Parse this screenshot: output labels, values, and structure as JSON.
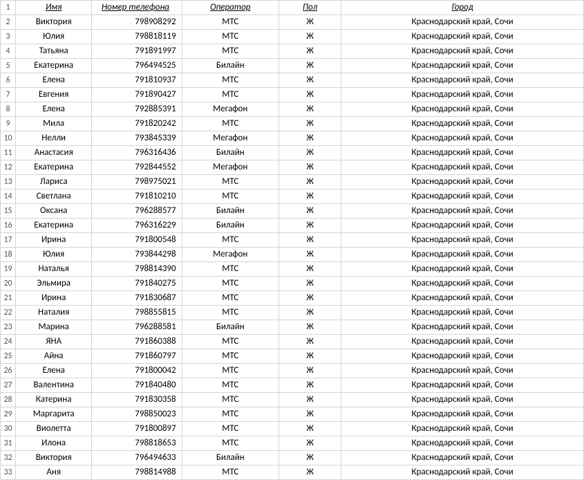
{
  "headers": {
    "rownum": "1",
    "name": "Имя",
    "phone": "Номер телефона",
    "operator": "Оператор",
    "sex": "Пол",
    "city": "Город"
  },
  "rows": [
    {
      "n": "2",
      "name": "Виктория",
      "phone": "798908292",
      "op": "МТС",
      "sex": "Ж",
      "city": "Краснодарский край, Сочи"
    },
    {
      "n": "3",
      "name": "Юлия",
      "phone": "798818119",
      "op": "МТС",
      "sex": "Ж",
      "city": "Краснодарский край, Сочи"
    },
    {
      "n": "4",
      "name": "Татьяна",
      "phone": "791891997",
      "op": "МТС",
      "sex": "Ж",
      "city": "Краснодарский край, Сочи"
    },
    {
      "n": "5",
      "name": "Екатерина",
      "phone": "796494525",
      "op": "Билайн",
      "sex": "Ж",
      "city": "Краснодарский край, Сочи"
    },
    {
      "n": "6",
      "name": "Елена",
      "phone": "791810937",
      "op": "МТС",
      "sex": "Ж",
      "city": "Краснодарский край, Сочи"
    },
    {
      "n": "7",
      "name": "Евгения",
      "phone": "791890427",
      "op": "МТС",
      "sex": "Ж",
      "city": "Краснодарский край, Сочи"
    },
    {
      "n": "8",
      "name": "Елена",
      "phone": "792885391",
      "op": "Мегафон",
      "sex": "Ж",
      "city": "Краснодарский край, Сочи"
    },
    {
      "n": "9",
      "name": "Мила",
      "phone": "791820242",
      "op": "МТС",
      "sex": "Ж",
      "city": "Краснодарский край, Сочи"
    },
    {
      "n": "10",
      "name": "Нелли",
      "phone": "793845339",
      "op": "Мегафон",
      "sex": "Ж",
      "city": "Краснодарский край, Сочи"
    },
    {
      "n": "11",
      "name": "Анастасия",
      "phone": "796316436",
      "op": "Билайн",
      "sex": "Ж",
      "city": "Краснодарский край, Сочи"
    },
    {
      "n": "12",
      "name": "Екатерина",
      "phone": "792844552",
      "op": "Мегафон",
      "sex": "Ж",
      "city": "Краснодарский край, Сочи"
    },
    {
      "n": "13",
      "name": "Лариса",
      "phone": "798975021",
      "op": "МТС",
      "sex": "Ж",
      "city": "Краснодарский край, Сочи"
    },
    {
      "n": "14",
      "name": "Светлана",
      "phone": "791810210",
      "op": "МТС",
      "sex": "Ж",
      "city": "Краснодарский край, Сочи"
    },
    {
      "n": "15",
      "name": "Оксана",
      "phone": "796288577",
      "op": "Билайн",
      "sex": "Ж",
      "city": "Краснодарский край, Сочи"
    },
    {
      "n": "16",
      "name": "Екатерина",
      "phone": "796316229",
      "op": "Билайн",
      "sex": "Ж",
      "city": "Краснодарский край, Сочи"
    },
    {
      "n": "17",
      "name": "Ирина",
      "phone": "791800548",
      "op": "МТС",
      "sex": "Ж",
      "city": "Краснодарский край, Сочи"
    },
    {
      "n": "18",
      "name": "Юлия",
      "phone": "793844298",
      "op": "Мегафон",
      "sex": "Ж",
      "city": "Краснодарский край, Сочи"
    },
    {
      "n": "19",
      "name": "Наталья",
      "phone": "798814390",
      "op": "МТС",
      "sex": "Ж",
      "city": "Краснодарский край, Сочи"
    },
    {
      "n": "20",
      "name": "Эльмира",
      "phone": "791840275",
      "op": "МТС",
      "sex": "Ж",
      "city": "Краснодарский край, Сочи"
    },
    {
      "n": "21",
      "name": "Ирина",
      "phone": "791830687",
      "op": "МТС",
      "sex": "Ж",
      "city": "Краснодарский край, Сочи"
    },
    {
      "n": "22",
      "name": "Наталия",
      "phone": "798855815",
      "op": "МТС",
      "sex": "Ж",
      "city": "Краснодарский край, Сочи"
    },
    {
      "n": "23",
      "name": "Марина",
      "phone": "796288581",
      "op": "Билайн",
      "sex": "Ж",
      "city": "Краснодарский край, Сочи"
    },
    {
      "n": "24",
      "name": "ЯНА",
      "phone": "791860388",
      "op": "МТС",
      "sex": "Ж",
      "city": "Краснодарский край, Сочи"
    },
    {
      "n": "25",
      "name": "Айна",
      "phone": "791860797",
      "op": "МТС",
      "sex": "Ж",
      "city": "Краснодарский край, Сочи"
    },
    {
      "n": "26",
      "name": "Елена",
      "phone": "791800042",
      "op": "МТС",
      "sex": "Ж",
      "city": "Краснодарский край, Сочи"
    },
    {
      "n": "27",
      "name": "Валентина",
      "phone": "791840480",
      "op": "МТС",
      "sex": "Ж",
      "city": "Краснодарский край, Сочи"
    },
    {
      "n": "28",
      "name": "Катерина",
      "phone": "791830358",
      "op": "МТС",
      "sex": "Ж",
      "city": "Краснодарский край, Сочи"
    },
    {
      "n": "29",
      "name": "Маргарита",
      "phone": "798850023",
      "op": "МТС",
      "sex": "Ж",
      "city": "Краснодарский край, Сочи"
    },
    {
      "n": "30",
      "name": "Виолетта",
      "phone": "791800897",
      "op": "МТС",
      "sex": "Ж",
      "city": "Краснодарский край, Сочи"
    },
    {
      "n": "31",
      "name": "Илона",
      "phone": "798818653",
      "op": "МТС",
      "sex": "Ж",
      "city": "Краснодарский край, Сочи"
    },
    {
      "n": "32",
      "name": "Виктория",
      "phone": "796494633",
      "op": "Билайн",
      "sex": "Ж",
      "city": "Краснодарский край, Сочи"
    },
    {
      "n": "33",
      "name": "Аня",
      "phone": "798814988",
      "op": "МТС",
      "sex": "Ж",
      "city": "Краснодарский край, Сочи"
    }
  ]
}
